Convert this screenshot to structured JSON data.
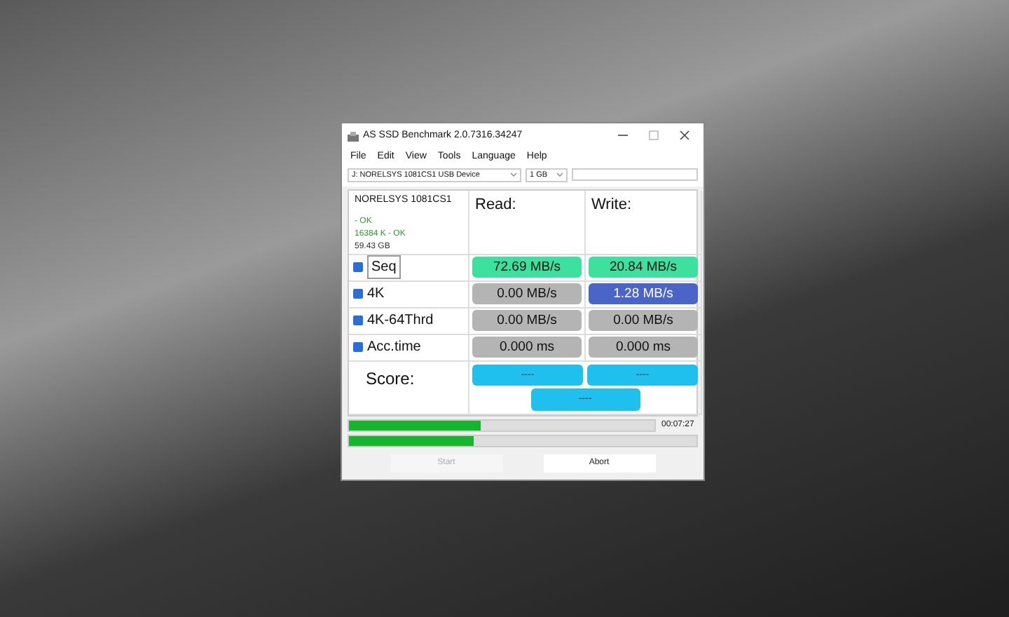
{
  "window": {
    "title": "AS SSD Benchmark 2.0.7316.34247"
  },
  "menu": [
    "File",
    "Edit",
    "View",
    "Tools",
    "Language",
    "Help"
  ],
  "toolbar": {
    "drive": "J: NORELSYS 1081CS1 USB Device",
    "size": "1 GB"
  },
  "drive_info": {
    "name": "NORELSYS 1081CS1",
    "lines": [
      "- OK",
      "16384 K - OK",
      "59.43 GB"
    ]
  },
  "headers": {
    "read": "Read:",
    "write": "Write:"
  },
  "tests": [
    {
      "label": "Seq",
      "checked": true,
      "read": {
        "value": "72.69 MB/s",
        "color": "#3ee0a0"
      },
      "write": {
        "value": "20.84 MB/s",
        "color": "#3ee0a0"
      }
    },
    {
      "label": "4K",
      "checked": true,
      "read": {
        "value": "0.00 MB/s",
        "color": "#b4b4b4"
      },
      "write": {
        "value": "1.28 MB/s",
        "color": "#4a64c8"
      }
    },
    {
      "label": "4K-64Thrd",
      "checked": true,
      "read": {
        "value": "0.00 MB/s",
        "color": "#b4b4b4"
      },
      "write": {
        "value": "0.00 MB/s",
        "color": "#b4b4b4"
      }
    },
    {
      "label": "Acc.time",
      "checked": true,
      "read": {
        "value": "0.000 ms",
        "color": "#b4b4b4"
      },
      "write": {
        "value": "0.000 ms",
        "color": "#b4b4b4"
      }
    }
  ],
  "score": {
    "label": "Score:",
    "read": "----",
    "write": "----",
    "total": "----"
  },
  "progress": [
    {
      "level": 0.43,
      "time": "00:07:27"
    },
    {
      "level": 0.36
    }
  ],
  "buttons": [
    {
      "label": "Start",
      "disabled": true
    },
    {
      "label": "Abort",
      "disabled": false
    }
  ]
}
